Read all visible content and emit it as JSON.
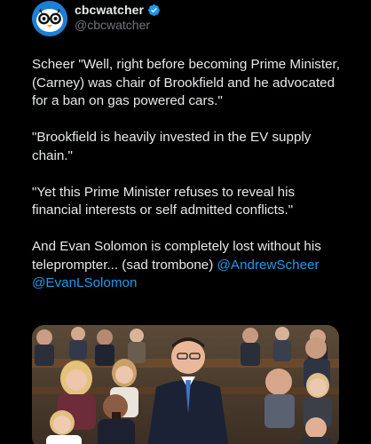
{
  "author": {
    "display_name": "cbcwatcher",
    "handle": "@cbcwatcher",
    "avatar_icon": "owl-glasses-icon",
    "verified_icon": "verified-badge-icon",
    "verified_color": "#1d9bf0"
  },
  "tweet": {
    "paragraphs": [
      "Scheer \"Well, right before becoming Prime Minister, (Carney) was chair of Brookfield and he advocated for a ban on gas powered cars.\"",
      "\"Brookfield is heavily invested in the EV supply chain.\"",
      "\"Yet this Prime Minister refuses to reveal his financial interests or self admitted conflicts.\""
    ],
    "final_text": "And Evan Solomon is completely lost without his teleprompter... (sad trombone) ",
    "mentions": [
      "@AndrewScheer",
      "@EvanLSolomon"
    ]
  },
  "media": {
    "kind": "photo",
    "scene_icon": "house-of-commons-photo"
  },
  "colors": {
    "background": "#000000",
    "text": "#e7e9ea",
    "secondary": "#71767b",
    "link": "#1d9bf0"
  }
}
